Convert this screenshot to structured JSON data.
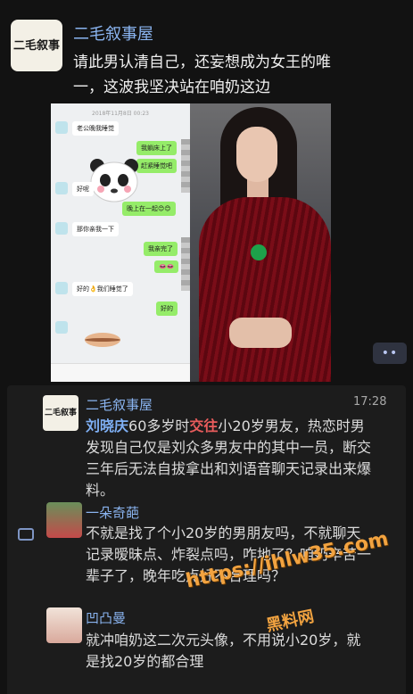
{
  "post": {
    "avatar_logo": "二毛叙事",
    "author": "二毛叙事屋",
    "caption_line1": "请此男认清自己，还妄想成为女王的唯",
    "caption_line2": "一，这波我坚决站在咱奶这边"
  },
  "media": {
    "chat_timestamp": "2018年11月8日 00:23",
    "messages": [
      {
        "side": "l",
        "text": "老公晚我睡觉"
      },
      {
        "side": "r",
        "text": "我躺床上了"
      },
      {
        "side": "r",
        "text": "赶紧睡觉吧"
      },
      {
        "side": "l",
        "text": "好呢"
      },
      {
        "side": "r",
        "text": "晚上在一起😊😊"
      },
      {
        "side": "l",
        "text": "那你亲我一下"
      },
      {
        "side": "r",
        "text": "我亲完了"
      },
      {
        "side": "r",
        "text": "👄👄"
      },
      {
        "side": "l",
        "text": "好的👌我们睡觉了"
      },
      {
        "side": "r",
        "text": "好的"
      }
    ]
  },
  "more_button": "••",
  "comments": [
    {
      "name": "二毛叙事屋",
      "time": "17:28",
      "parts": [
        {
          "t": "刘晓庆",
          "c": "blue"
        },
        {
          "t": "60多岁时",
          "c": ""
        },
        {
          "t": "交往",
          "c": "red"
        },
        {
          "t": "小20岁男友，热恋时男发现自己仅是刘众多男友中的其中一员，断交三年后无法自拔拿出和刘语音聊天记录出来爆料。",
          "c": ""
        }
      ]
    },
    {
      "name": "一朵奇葩",
      "text": "不就是找了个小20岁的男朋友吗，不就聊天记录暧昧点、炸裂点吗，咋地了？咱奶辛苦一辈子了，晚年吃点好不合理吗？"
    },
    {
      "name": "凹凸曼",
      "text": "就冲咱奶这二次元头像，不用说小20岁，就是找20岁的都合理"
    }
  ],
  "watermark": {
    "url": "https://ihlw35.com",
    "name": "黑料网"
  }
}
